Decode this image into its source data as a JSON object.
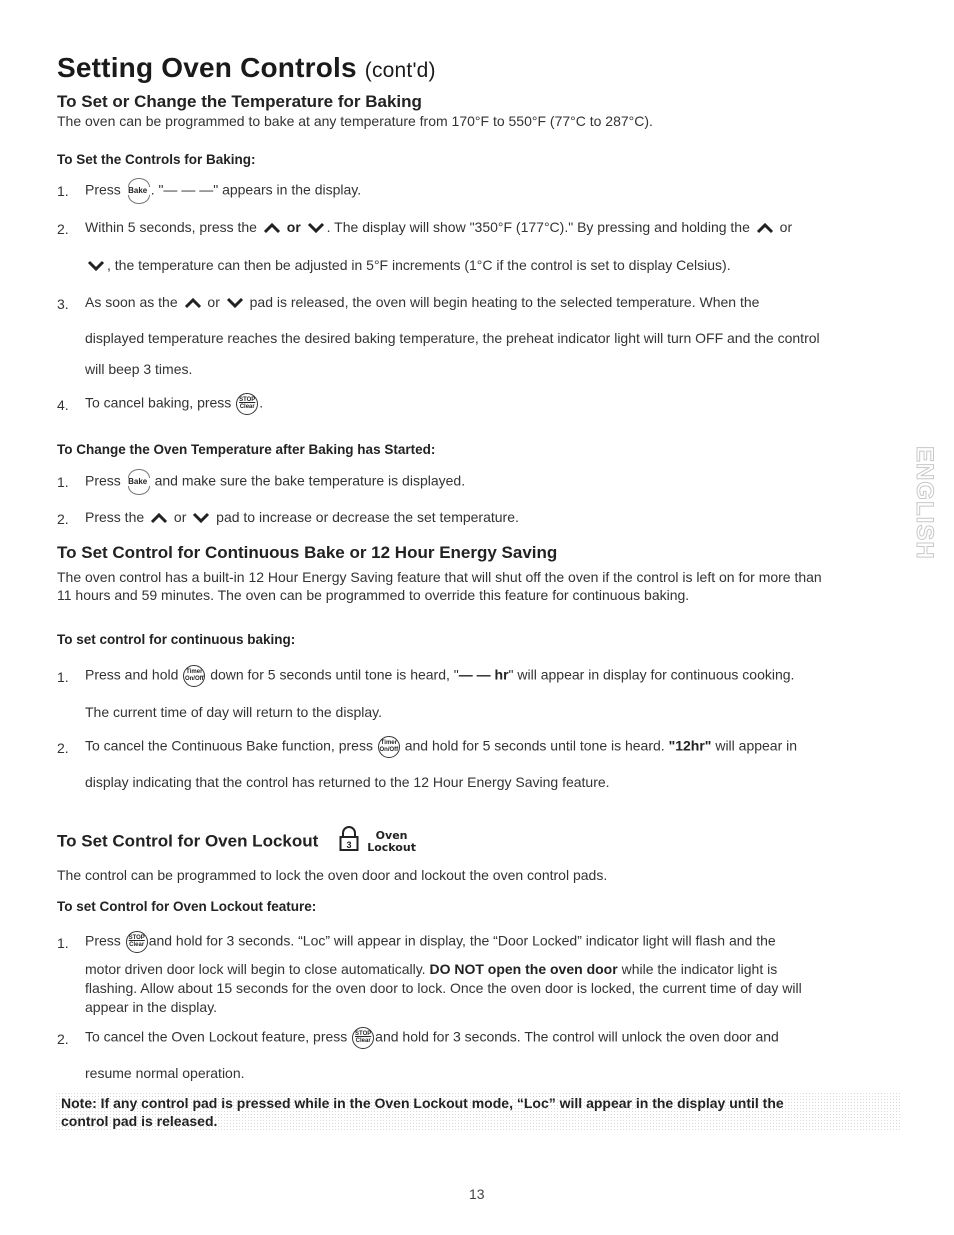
{
  "page": {
    "title": "Setting Oven Controls",
    "title_suffix": "(cont'd)",
    "side_tab": "ENGLISH",
    "page_number": "13"
  },
  "icons": {
    "bake_pad": "Bake",
    "stop_clear_pad": [
      "STOP",
      "Clear"
    ],
    "timer_pad": [
      "Timer",
      "On/Off"
    ],
    "up_arrow": "up-arrow-pad",
    "down_arrow": "down-arrow-pad",
    "lock_pad_number": "3",
    "lock_label": [
      "Oven",
      "Lockout"
    ]
  },
  "section1": {
    "heading": "To Set or Change the Temperature for Baking",
    "intro": "The oven can be programmed to bake at any temperature from 170°F to 550°F (77°C to 287°C).",
    "sub1": {
      "heading": "To Set the Controls for Baking:",
      "steps": [
        {
          "num": "1.",
          "a": "Press",
          "b": ". \"— — —\" appears in the display."
        },
        {
          "num": "2.",
          "a": "Within 5 seconds, press the",
          "or": "or",
          "b": ". The display will show \"350°F (177°C).\" By pressing and holding the",
          "c": "or",
          "line2": ", the temperature can then be adjusted in 5°F increments (1°C if the control is set to display Celsius)."
        },
        {
          "num": "3.",
          "a": "As soon as the",
          "or": "or",
          "b": "pad is released, the oven will begin heating to the selected temperature. When the",
          "line2": "displayed temperature reaches the desired baking temperature, the preheat indicator light will turn OFF and the control",
          "line3": "will beep 3 times."
        },
        {
          "num": "4.",
          "a": "To cancel baking, press",
          "b": "."
        }
      ]
    },
    "sub2": {
      "heading": "To Change the Oven Temperature after Baking has Started:",
      "steps": [
        {
          "num": "1.",
          "a": "Press",
          "b": "and make sure the bake temperature is displayed."
        },
        {
          "num": "2.",
          "a": "Press the",
          "or": "or",
          "b": "pad to increase or decrease the set temperature."
        }
      ]
    }
  },
  "section2": {
    "heading": "To Set Control for Continuous Bake or 12 Hour Energy Saving",
    "intro_line1": "The oven control has a built-in 12 Hour Energy Saving feature that will shut off the oven if the control is left on for more than",
    "intro_line2": "11 hours and 59 minutes. The oven can be programmed to override this feature for continuous baking.",
    "sub_heading": "To set control for continuous baking:",
    "steps": [
      {
        "num": "1.",
        "a": "Press and hold",
        "b": "down for 5 seconds until tone is heard, \"",
        "bold": "— —  hr",
        "c": "\" will appear in display for continuous cooking.",
        "line2": "The current time of day will return to the display."
      },
      {
        "num": "2.",
        "a": "To cancel the Continuous Bake function, press",
        "b": "and hold for 5 seconds until tone is heard.",
        "bold": "\"12hr\"",
        "c": "will appear in",
        "line2": "display indicating that the control has returned to the 12 Hour Energy Saving feature."
      }
    ]
  },
  "section3": {
    "heading": "To Set Control for Oven Lockout",
    "intro": "The control can be programmed to lock the oven door and lockout the oven control pads.",
    "sub_heading": "To set Control for Oven Lockout feature:",
    "steps": [
      {
        "num": "1.",
        "a": "Press",
        "b": "and hold for 3 seconds. “Loc” will appear in display, the “Door Locked” indicator light will flash and the",
        "line2a": "motor driven door lock will begin to close automatically.",
        "line2bold": "DO NOT open the oven door",
        "line2b": "while the indicator light is",
        "line3": "flashing. Allow about 15 seconds for the oven door to lock. Once the oven door is locked, the current time of day will",
        "line4": "appear in the display."
      },
      {
        "num": "2.",
        "a": "To cancel the Oven Lockout feature, press",
        "b": "and hold for 3 seconds. The control will unlock the oven door and",
        "line2": "resume normal operation."
      }
    ],
    "note_line1": "Note: If any control pad is pressed while in the Oven Lockout mode, “Loc” will appear in the display until the",
    "note_line2": "control pad is released."
  }
}
